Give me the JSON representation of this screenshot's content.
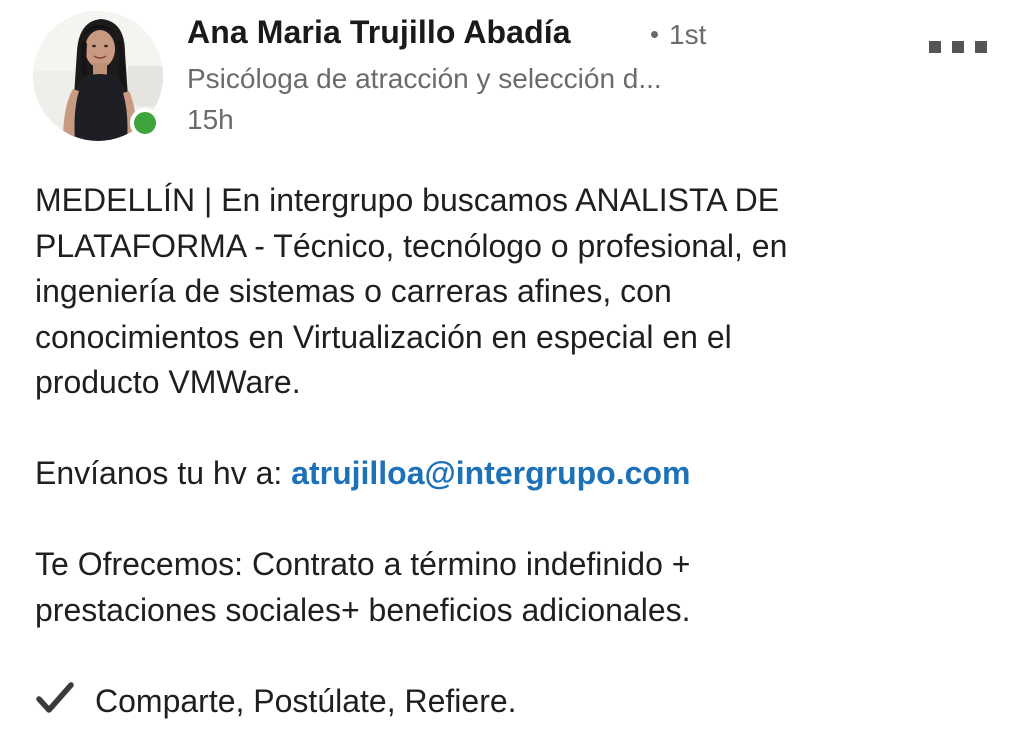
{
  "author": {
    "name": "Ana Maria Trujillo Abadía",
    "degree": "1st",
    "headline": "Psicóloga de atracción y selección d...",
    "time": "15h",
    "online_color": "#3ea43c",
    "avatar_icon": "profile-photo"
  },
  "post": {
    "line1": "MEDELLÍN | En intergrupo buscamos ANALISTA DE",
    "line2": "PLATAFORMA -  Técnico, tecnólogo o profesional, en",
    "line3": "ingeniería de sistemas o carreras afines, con",
    "line4": "conocimientos en Virtualización en especial en el",
    "line5": "producto VMWare.",
    "send_prefix": "Envíanos tu hv a: ",
    "email": "atrujilloa@intergrupo.com",
    "offer1": "Te Ofrecemos: Contrato a término indefinido +",
    "offer2": "prestaciones sociales+ beneficios adicionales.",
    "cta_icon": "check-mark-icon",
    "cta": "Comparte, Postúlate, Refiere."
  },
  "colors": {
    "link": "#1d71b8",
    "text": "#1f1f1f",
    "muted": "#6b6b6b"
  },
  "menu": {
    "icon": "more-options-icon"
  }
}
